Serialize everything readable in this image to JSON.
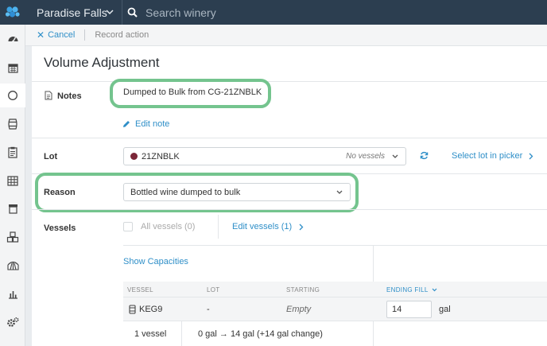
{
  "header": {
    "winery_name": "Paradise Falls",
    "search_placeholder": "Search winery"
  },
  "actionbar": {
    "cancel_label": "Cancel",
    "record_label": "Record action"
  },
  "page": {
    "title": "Volume Adjustment"
  },
  "notes": {
    "label": "Notes",
    "value": "Dumped to Bulk from CG-21ZNBLK",
    "edit_label": "Edit note"
  },
  "lot": {
    "label": "Lot",
    "value": "21ZNBLK",
    "vessels_hint": "No vessels",
    "picker_label": "Select lot in picker",
    "color": "#7b2638"
  },
  "reason": {
    "label": "Reason",
    "value": "Bottled wine dumped to bulk"
  },
  "vessels": {
    "label": "Vessels",
    "all_label": "All vessels (0)",
    "edit_label": "Edit vessels (1)",
    "show_capacities": "Show Capacities"
  },
  "table": {
    "headers": [
      "VESSEL",
      "LOT",
      "STARTING",
      "ENDING FILL"
    ],
    "rows": [
      {
        "vessel": "KEG9",
        "lot": "-",
        "starting": "Empty",
        "ending_fill": "14",
        "unit": "gal"
      }
    ],
    "footer": {
      "count": "1 vessel",
      "change": "0 gal → 14 gal (+14 gal change)"
    }
  },
  "colors": {
    "topbar": "#2c3e50",
    "accent": "#2f8fc8",
    "highlight": "#74c48e"
  }
}
